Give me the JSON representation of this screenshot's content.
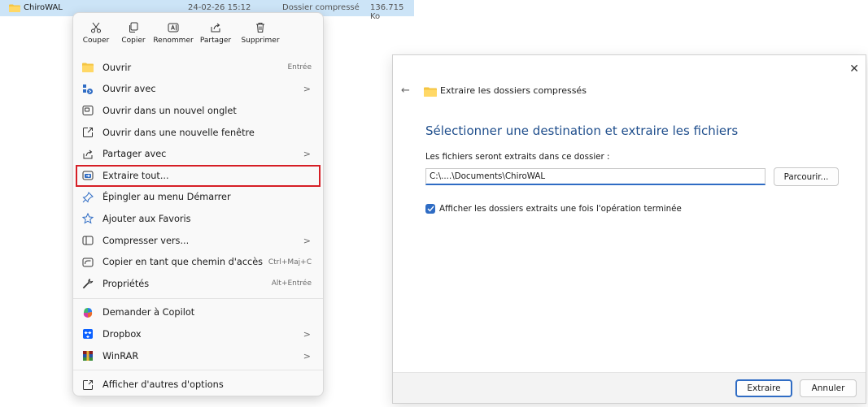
{
  "file_row": {
    "name": "ChiroWAL",
    "date": "24-02-26 15:12",
    "type": "Dossier compressé",
    "size": "136.715 Ko",
    "icon": "zip-folder-icon"
  },
  "context_menu": {
    "quick_actions": [
      {
        "label": "Couper",
        "icon": "scissors-icon"
      },
      {
        "label": "Copier",
        "icon": "copy-icon"
      },
      {
        "label": "Renommer",
        "icon": "rename-icon"
      },
      {
        "label": "Partager",
        "icon": "share-icon"
      },
      {
        "label": "Supprimer",
        "icon": "trash-icon"
      }
    ],
    "items": [
      {
        "label": "Ouvrir",
        "shortcut": "Entrée",
        "icon": "folder-icon"
      },
      {
        "label": "Ouvrir avec",
        "chevron": ">",
        "icon": "open-with-icon"
      },
      {
        "label": "Ouvrir dans un nouvel onglet",
        "icon": "new-tab-icon"
      },
      {
        "label": "Ouvrir dans une nouvelle fenêtre",
        "icon": "new-window-icon"
      },
      {
        "label": "Partager avec",
        "chevron": ">",
        "icon": "share-icon"
      },
      {
        "label": "Extraire tout...",
        "icon": "extract-icon",
        "highlighted": true
      },
      {
        "label": "Épingler au menu Démarrer",
        "icon": "pin-icon"
      },
      {
        "label": "Ajouter aux Favoris",
        "icon": "star-icon"
      },
      {
        "label": "Compresser vers...",
        "chevron": ">",
        "icon": "compress-icon"
      },
      {
        "label": "Copier en tant que chemin d'accès",
        "shortcut": "Ctrl+Maj+C",
        "icon": "copy-path-icon"
      },
      {
        "label": "Propriétés",
        "shortcut": "Alt+Entrée",
        "icon": "wrench-icon"
      },
      {
        "label": "Demander à Copilot",
        "icon": "copilot-icon"
      },
      {
        "label": "Dropbox",
        "chevron": ">",
        "icon": "dropbox-icon"
      },
      {
        "label": "WinRAR",
        "chevron": ">",
        "icon": "winrar-icon"
      },
      {
        "label": "Afficher d'autres d'options",
        "icon": "more-options-icon"
      }
    ]
  },
  "dialog": {
    "close": "✕",
    "back": "←",
    "title": "Extraire les dossiers compressés",
    "heading": "Sélectionner une destination et extraire les fichiers",
    "label": "Les fichiers seront extraits dans ce dossier :",
    "path_value": "C:\\....\\Documents\\ChiroWAL",
    "browse_label": "Parcourir...",
    "checkbox_label": "Afficher les dossiers extraits une fois l'opération terminée",
    "checkbox_checked": true,
    "extract_label": "Extraire",
    "cancel_label": "Annuler"
  },
  "colors": {
    "accent": "#2f6cc4",
    "highlight": "#d61f26",
    "heading": "#1f4e8c",
    "selection": "#cce4f7"
  }
}
